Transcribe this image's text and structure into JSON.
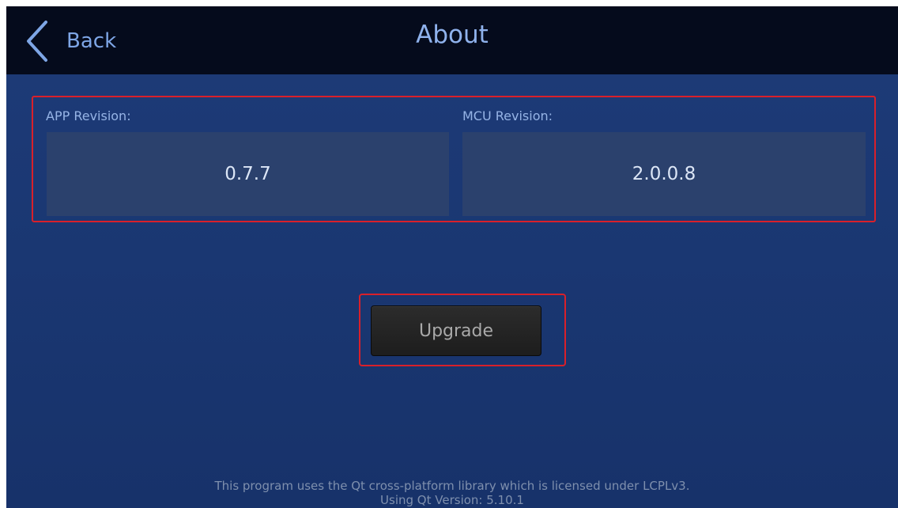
{
  "header": {
    "back_label": "Back",
    "title": "About"
  },
  "revisions": {
    "app_label": "APP Revision:",
    "app_value": "0.7.7",
    "mcu_label": "MCU Revision:",
    "mcu_value": "2.0.0.8"
  },
  "actions": {
    "upgrade_label": "Upgrade"
  },
  "footer": {
    "license_text": "This program uses the Qt cross-platform library which is licensed under LCPLv3.",
    "qt_version_text": "Using Qt Version: 5.10.1"
  },
  "colors": {
    "background": "#1b3874",
    "topbar": "#050b1c",
    "accent_text": "#8fb2ec",
    "highlight_border": "#d9202a",
    "value_panel": "#2b416d",
    "button": "#222222"
  },
  "icons": {
    "back": "chevron-left-icon"
  }
}
